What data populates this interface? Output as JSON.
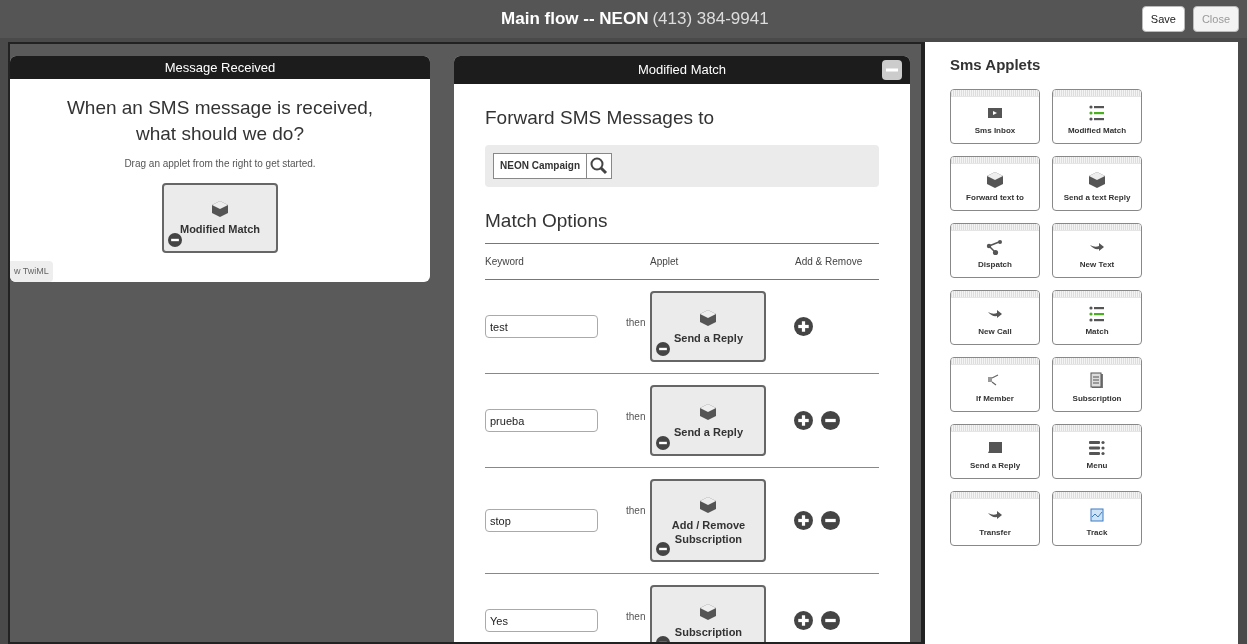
{
  "header": {
    "title": "Main flow -- NEON",
    "phone": "(413) 384-9941",
    "buttons": [
      {
        "label": "Save",
        "disabled": false
      },
      {
        "label": "Close",
        "disabled": true
      }
    ]
  },
  "start_card": {
    "title": "Message Received",
    "heading": "When an SMS message is received, what should we do?",
    "hint": "Drag an applet from the right to get started.",
    "applet": "Modified Match",
    "twiml_button": "w TwiML"
  },
  "match_card": {
    "title": "Modified Match",
    "forward_heading": "Forward SMS Messages to",
    "forward_value": "NEON Campaign",
    "options_heading": "Match Options",
    "columns": [
      "Keyword",
      "Applet",
      "Add & Remove"
    ],
    "rows": [
      {
        "keyword": "test",
        "then_label": "then",
        "applet": "Send a Reply",
        "removable": false
      },
      {
        "keyword": "prueba",
        "then_label": "then",
        "applet": "Send a Reply",
        "removable": true
      },
      {
        "keyword": "stop",
        "then_label": "then",
        "applet": "Add / Remove Subscription",
        "removable": true
      },
      {
        "keyword": "Yes",
        "then_label": "then",
        "applet": "Subscription",
        "removable": true
      }
    ]
  },
  "sidebar": {
    "title": "Sms Applets",
    "applets": [
      {
        "label": "Sms Inbox",
        "kind": "inbox"
      },
      {
        "label": "Modified Match",
        "kind": "list"
      },
      {
        "label": "Forward text to",
        "kind": "box"
      },
      {
        "label": "Send a text Reply",
        "kind": "box"
      },
      {
        "label": "Dispatch",
        "kind": "dispatch"
      },
      {
        "label": "New Text",
        "kind": "arrow"
      },
      {
        "label": "New Call",
        "kind": "arrow"
      },
      {
        "label": "Match",
        "kind": "list"
      },
      {
        "label": "If Member",
        "kind": "member"
      },
      {
        "label": "Subscription",
        "kind": "doc"
      },
      {
        "label": "Send a Reply",
        "kind": "reply"
      },
      {
        "label": "Menu",
        "kind": "menu"
      },
      {
        "label": "Transfer",
        "kind": "arrow"
      },
      {
        "label": "Track",
        "kind": "chart"
      }
    ]
  }
}
